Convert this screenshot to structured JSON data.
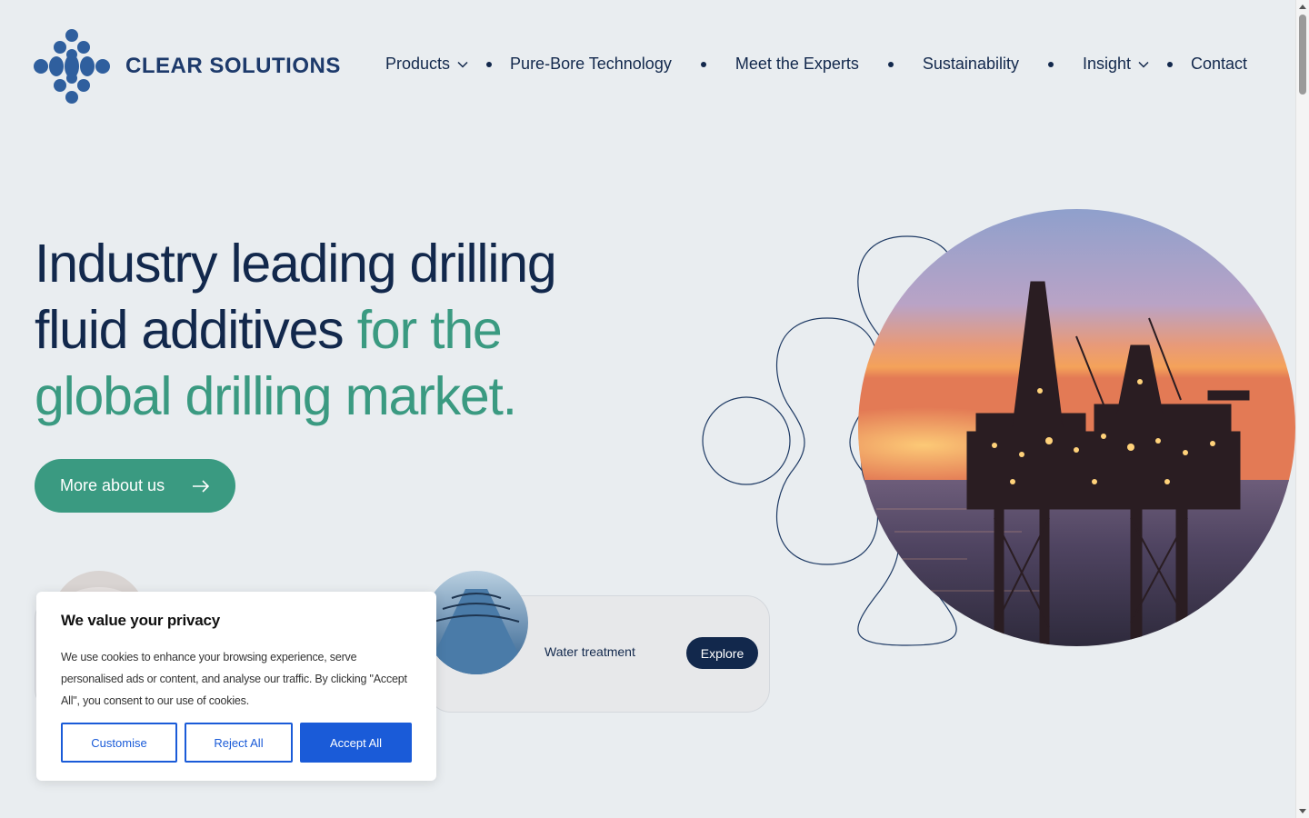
{
  "brand": {
    "name": "CLEAR SOLUTIONS"
  },
  "nav": {
    "items": [
      {
        "label": "Products",
        "has_dropdown": true
      },
      {
        "label": "Pure-Bore Technology",
        "has_dropdown": false
      },
      {
        "label": "Meet the Experts",
        "has_dropdown": false
      },
      {
        "label": "Sustainability",
        "has_dropdown": false
      },
      {
        "label": "Insight",
        "has_dropdown": true
      },
      {
        "label": "Contact",
        "has_dropdown": false
      }
    ]
  },
  "hero": {
    "title_line1": "Industry leading drilling",
    "title_line2_dark": "fluid additives ",
    "title_line2_green": "for the",
    "title_line3_green": "global drilling market.",
    "cta_label": "More about us",
    "image_alt": "Offshore drilling rig at sunset"
  },
  "cards": [
    {
      "label": "",
      "icon": "mineral-thumbnail"
    },
    {
      "label": "Water treatment",
      "button": "Explore",
      "icon": "water-channel-thumbnail"
    }
  ],
  "cookie": {
    "title": "We value your privacy",
    "body": "We use cookies to enhance your browsing experience, serve personalised ads or content, and analyse our traffic. By clicking \"Accept All\", you consent to our use of cookies.",
    "customise": "Customise",
    "reject": "Reject All",
    "accept": "Accept All"
  },
  "colors": {
    "navy": "#12284c",
    "green": "#3a9a81",
    "background": "#e9edf0",
    "cookie_blue": "#1a5bd8"
  }
}
